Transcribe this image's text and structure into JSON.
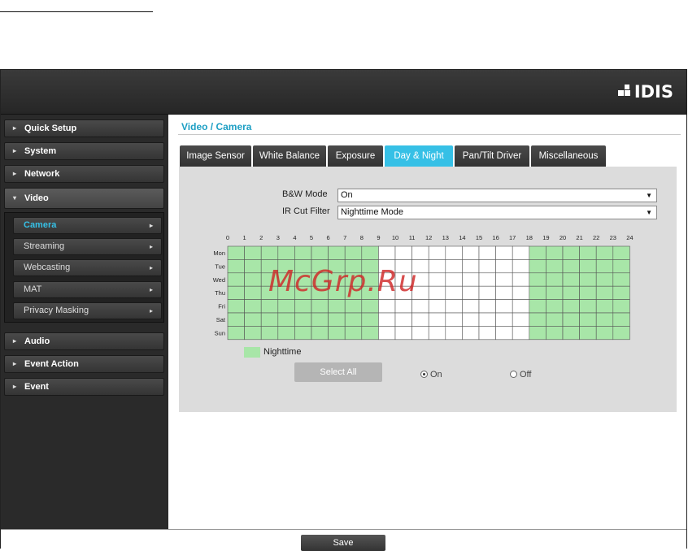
{
  "brand": {
    "logo_text": "IDIS"
  },
  "sidebar": {
    "items": [
      {
        "label": "Quick Setup",
        "expanded": false
      },
      {
        "label": "System",
        "expanded": false
      },
      {
        "label": "Network",
        "expanded": false
      },
      {
        "label": "Video",
        "expanded": true
      },
      {
        "label": "Audio",
        "expanded": false
      },
      {
        "label": "Event Action",
        "expanded": false
      },
      {
        "label": "Event",
        "expanded": false
      }
    ],
    "video_submenu": [
      {
        "label": "Camera",
        "active": true
      },
      {
        "label": "Streaming",
        "active": false
      },
      {
        "label": "Webcasting",
        "active": false
      },
      {
        "label": "MAT",
        "active": false
      },
      {
        "label": "Privacy Masking",
        "active": false
      }
    ]
  },
  "main": {
    "breadcrumb": "Video / Camera",
    "tabs": [
      {
        "label": "Image Sensor",
        "active": false
      },
      {
        "label": "White Balance",
        "active": false
      },
      {
        "label": "Exposure",
        "active": false
      },
      {
        "label": "Day & Night",
        "active": true
      },
      {
        "label": "Pan/Tilt Driver",
        "active": false
      },
      {
        "label": "Miscellaneous",
        "active": false
      }
    ],
    "bw_mode": {
      "label": "B&W Mode",
      "value": "On"
    },
    "ir_cut_filter": {
      "label": "IR Cut Filter",
      "value": "Nighttime Mode"
    },
    "schedule": {
      "hours": [
        "0",
        "1",
        "2",
        "3",
        "4",
        "5",
        "6",
        "7",
        "8",
        "9",
        "10",
        "11",
        "12",
        "13",
        "14",
        "15",
        "16",
        "17",
        "18",
        "19",
        "20",
        "21",
        "22",
        "23",
        "24"
      ],
      "days": [
        "Mon",
        "Tue",
        "Wed",
        "Thu",
        "Fri",
        "Sat",
        "Sun"
      ],
      "nighttime_hours": [
        0,
        1,
        2,
        3,
        4,
        5,
        6,
        7,
        8,
        18,
        19,
        20,
        21,
        22,
        23
      ]
    },
    "legend_label": "Nighttime",
    "select_all_label": "Select All",
    "radio_on_label": "On",
    "radio_off_label": "Off",
    "radio_selected": "On"
  },
  "footer": {
    "save_label": "Save"
  },
  "watermark_text": "McGrp.Ru",
  "colors": {
    "accent": "#36c0e6",
    "nighttime": "#a8e6a8",
    "header_bg": "#2f2f2f",
    "sidebar_bg": "#2a2a2a",
    "panel_bg": "#dcdcdc"
  }
}
